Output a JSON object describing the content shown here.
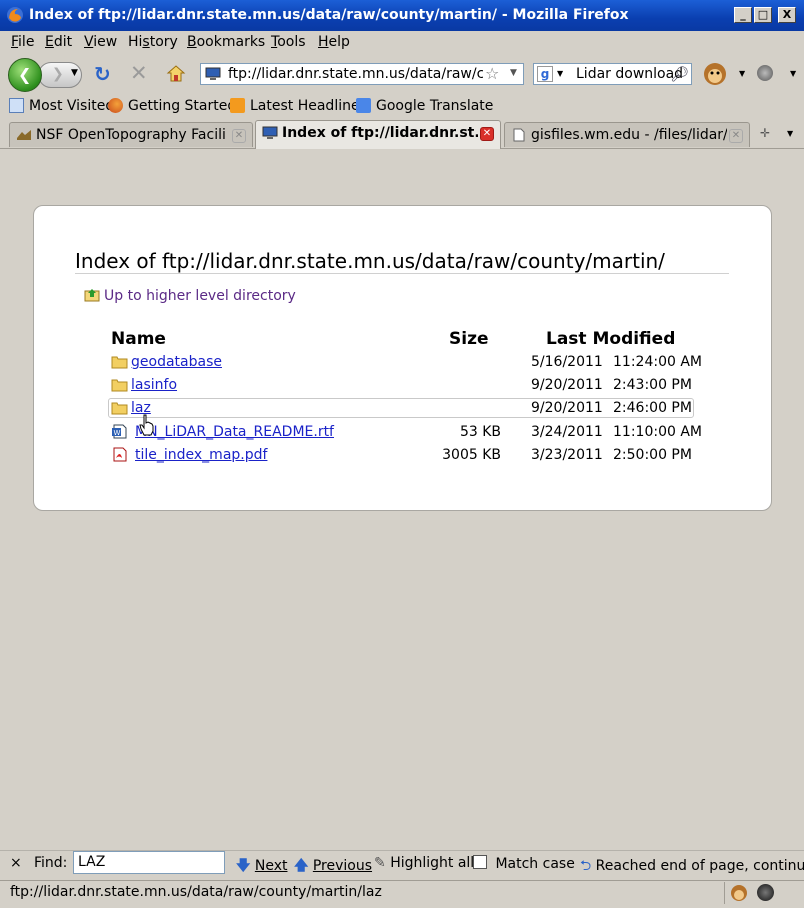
{
  "window": {
    "title": "Index of ftp://lidar.dnr.state.mn.us/data/raw/county/martin/ - Mozilla Firefox",
    "min_label": "_",
    "max_label": "□",
    "close_label": "X"
  },
  "menu": {
    "items": [
      {
        "key": "F",
        "rest": "ile"
      },
      {
        "key": "E",
        "rest": "dit"
      },
      {
        "key": "V",
        "rest": "iew"
      },
      {
        "key": "",
        "pre": "Hi",
        "key2": "s",
        "rest": "tory"
      },
      {
        "key": "B",
        "rest": "ookmarks"
      },
      {
        "key": "T",
        "rest": "ools"
      },
      {
        "key": "H",
        "rest": "elp"
      }
    ]
  },
  "navbar": {
    "url": "ftp://lidar.dnr.state.mn.us/data/raw/coun",
    "search_text": "Lidar download"
  },
  "bookmarks": [
    {
      "label": "Most Visited"
    },
    {
      "label": "Getting Started"
    },
    {
      "label": "Latest Headlines"
    },
    {
      "label": "Google Translate"
    }
  ],
  "tabs": [
    {
      "label": "NSF OpenTopography Facility",
      "active": false
    },
    {
      "label": "Index of ftp://lidar.dnr.st...",
      "active": true
    },
    {
      "label": "gisfiles.wm.edu - /files/lidar/ES...",
      "active": false
    }
  ],
  "page": {
    "heading": "Index of ftp://lidar.dnr.state.mn.us/data/raw/county/martin/",
    "up_link": "Up to higher level directory",
    "columns": {
      "name": "Name",
      "size": "Size",
      "modified": "Last Modified"
    },
    "rows": [
      {
        "name": "geodatabase",
        "type": "folder",
        "size": "",
        "date": "5/16/2011",
        "time": "11:24:00 AM"
      },
      {
        "name": "lasinfo",
        "type": "folder",
        "size": "",
        "date": "9/20/2011",
        "time": "2:43:00 PM"
      },
      {
        "name": "laz",
        "type": "folder",
        "size": "",
        "date": "9/20/2011",
        "time": "2:46:00 PM"
      },
      {
        "name": "MN_LiDAR_Data_README.rtf",
        "type": "doc",
        "size": "53 KB",
        "date": "3/24/2011",
        "time": "11:10:00 AM"
      },
      {
        "name": "tile_index_map.pdf",
        "type": "pdf",
        "size": "3005 KB",
        "date": "3/23/2011",
        "time": "2:50:00 PM"
      }
    ]
  },
  "findbar": {
    "close": "×",
    "label": "Find:",
    "value": "LAZ",
    "next": "Next",
    "previous": "Previous",
    "highlight": "Highlight all",
    "match_case": "Match case",
    "message": "Reached end of page, continued"
  },
  "status": {
    "text": "ftp://lidar.dnr.state.mn.us/data/raw/county/martin/laz"
  },
  "colors": {
    "title_bar": "#0a3fb0",
    "link": "#1a22c8",
    "visited": "#5b2a86",
    "chrome": "#d4d0c8"
  }
}
